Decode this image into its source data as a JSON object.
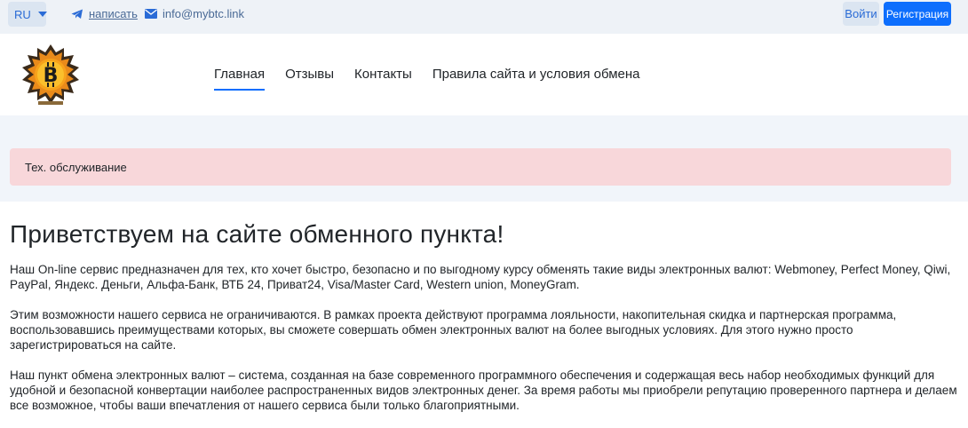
{
  "topbar": {
    "lang": "RU",
    "telegram_label": "написать",
    "email": "info@mybtc.link",
    "login_label": "Войти",
    "register_label": "Регистрация"
  },
  "nav": {
    "items": [
      {
        "label": "Главная",
        "active": true
      },
      {
        "label": "Отзывы",
        "active": false
      },
      {
        "label": "Контакты",
        "active": false
      },
      {
        "label": "Правила сайта и условия обмена",
        "active": false
      }
    ]
  },
  "alert": {
    "text": "Тех. обслуживание"
  },
  "main": {
    "heading": "Приветствуем на сайте обменного пункта!",
    "paragraphs": [
      "Наш On-line сервис предназначен для тех, кто хочет быстро, безопасно и по выгодному курсу обменять такие виды электронных валют: Webmoney, Perfect Money, Qiwi, PayPal, Яндекс. Деньги, Альфа-Банк, ВТБ 24, Приват24, Visa/Master Card, Western union, MoneyGram.",
      "Этим возможности нашего сервиса не ограничиваются. В рамках проекта действуют программа лояльности, накопительная скидка и партнерская программа, воспользовавшись преимуществами которых, вы сможете совершать обмен электронных валют на более выгодных условиях. Для этого нужно просто зарегистрироваться на сайте.",
      "Наш пункт обмена электронных валют – система, созданная на базе современного программного обеспечения и содержащая весь набор необходимых функций для удобной и безопасной конвертации наиболее распространенных видов электронных денег. За время работы мы приобрели репутацию проверенного партнера и делаем все возможное, чтобы ваши впечатления от нашего сервиса были только благоприятными."
    ]
  },
  "colors": {
    "primary": "#0d6efd",
    "alert_bg": "#f8d7da",
    "topbar_bg": "#eef2f7"
  }
}
